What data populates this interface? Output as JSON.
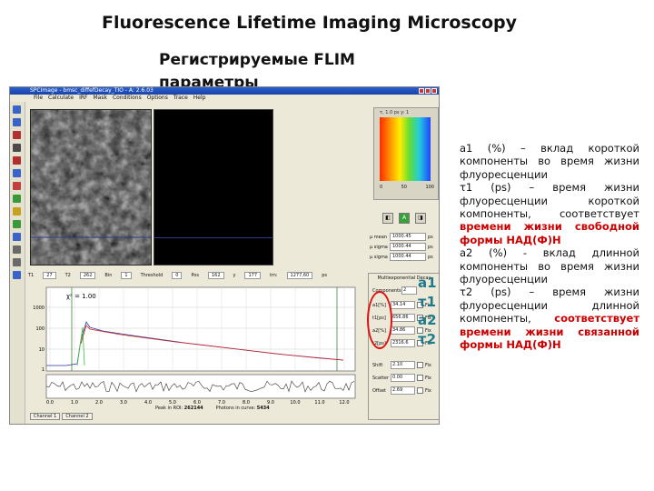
{
  "slide": {
    "title": "Fluorescence Lifetime Imaging Microscopy",
    "subtitle": "Регистрируемые FLIM параметры"
  },
  "app": {
    "window_title": "SPCImage - bmsc_diffefDecay_TIO - A: 2.6.03",
    "menu": [
      "File",
      "Calculate",
      "IRF",
      "Mask",
      "Conditions",
      "Options",
      "Trace",
      "Help"
    ],
    "colorbar_label": "τ, 1.0  ps    y: 1",
    "colorbar_ticks": [
      "0",
      "50",
      "100"
    ],
    "stats": [
      {
        "label": "μ mean",
        "value": "1000.45",
        "unit": "ps"
      },
      {
        "label": "μ sigma",
        "value": "1000.44",
        "unit": "ps"
      },
      {
        "label": "μ sigma",
        "value": "1000.44",
        "unit": "ps"
      }
    ],
    "params_row": {
      "t1_label": "T1",
      "t1": "27",
      "t2_label": "T2",
      "t2": "262",
      "bin_label": "Bin",
      "bin": "1",
      "threshold_label": "Threshold",
      "threshold": "0",
      "pos_label": "Pos",
      "pos": "162",
      "y_label": "y",
      "y": "177",
      "tm_label": "tm:",
      "tm": "1277,60",
      "tm_unit": "ps"
    },
    "plot": {
      "chi_label": "χ² = 1.00",
      "y_ticks": [
        "1000",
        "100",
        "10",
        "1"
      ],
      "x_ticks": [
        "0.0",
        "1.0",
        "2.0",
        "3.0",
        "4.0",
        "5.0",
        "6.0",
        "7.0",
        "8.0",
        "9.0",
        "10.0",
        "11.0",
        "12.0"
      ]
    },
    "multi_panel": {
      "title": "Multiexponential Decay",
      "rows": [
        {
          "label": "Components",
          "value": "2"
        },
        {
          "label": "a1[%]",
          "value": "34.14"
        },
        {
          "label": "t1[ps]",
          "value": "656.86"
        },
        {
          "label": "a2[%]",
          "value": "34.86"
        },
        {
          "label": "t2[ps]",
          "value": "2316.6"
        },
        {
          "label": "Shift",
          "value": "2.10"
        },
        {
          "label": "Scatter",
          "value": "0.00"
        },
        {
          "label": "Offset",
          "value": "2.69"
        }
      ],
      "fix_label": "Fix"
    },
    "tabs": [
      "Channel 1",
      "Channel 2"
    ],
    "footer": {
      "peak_label": "Peak in ROI:",
      "peak": "262144",
      "photons_label": "Photons in curve:",
      "photons": "5434"
    }
  },
  "param_labels": [
    "a1",
    "τ1",
    "a2",
    "τ2"
  ],
  "description": [
    {
      "text": "a1 (%) – вклад короткой компоненты во время жизни флуоресценции",
      "highlight": ""
    },
    {
      "text": "τ1 (ps) – время жизни флуоресценции короткой компоненты, соответствует",
      "highlight": "времени жизни свободной формы НАД(Ф)Н"
    },
    {
      "text": "a2 (%) - вклад длинной компоненты во время жизни флуоресценции",
      "highlight": ""
    },
    {
      "text": "τ2 (ps) – время жизни флуоресценции длинной компоненты,",
      "highlight": "соответствует времени жизни связанной формы НАД(Ф)Н"
    }
  ]
}
